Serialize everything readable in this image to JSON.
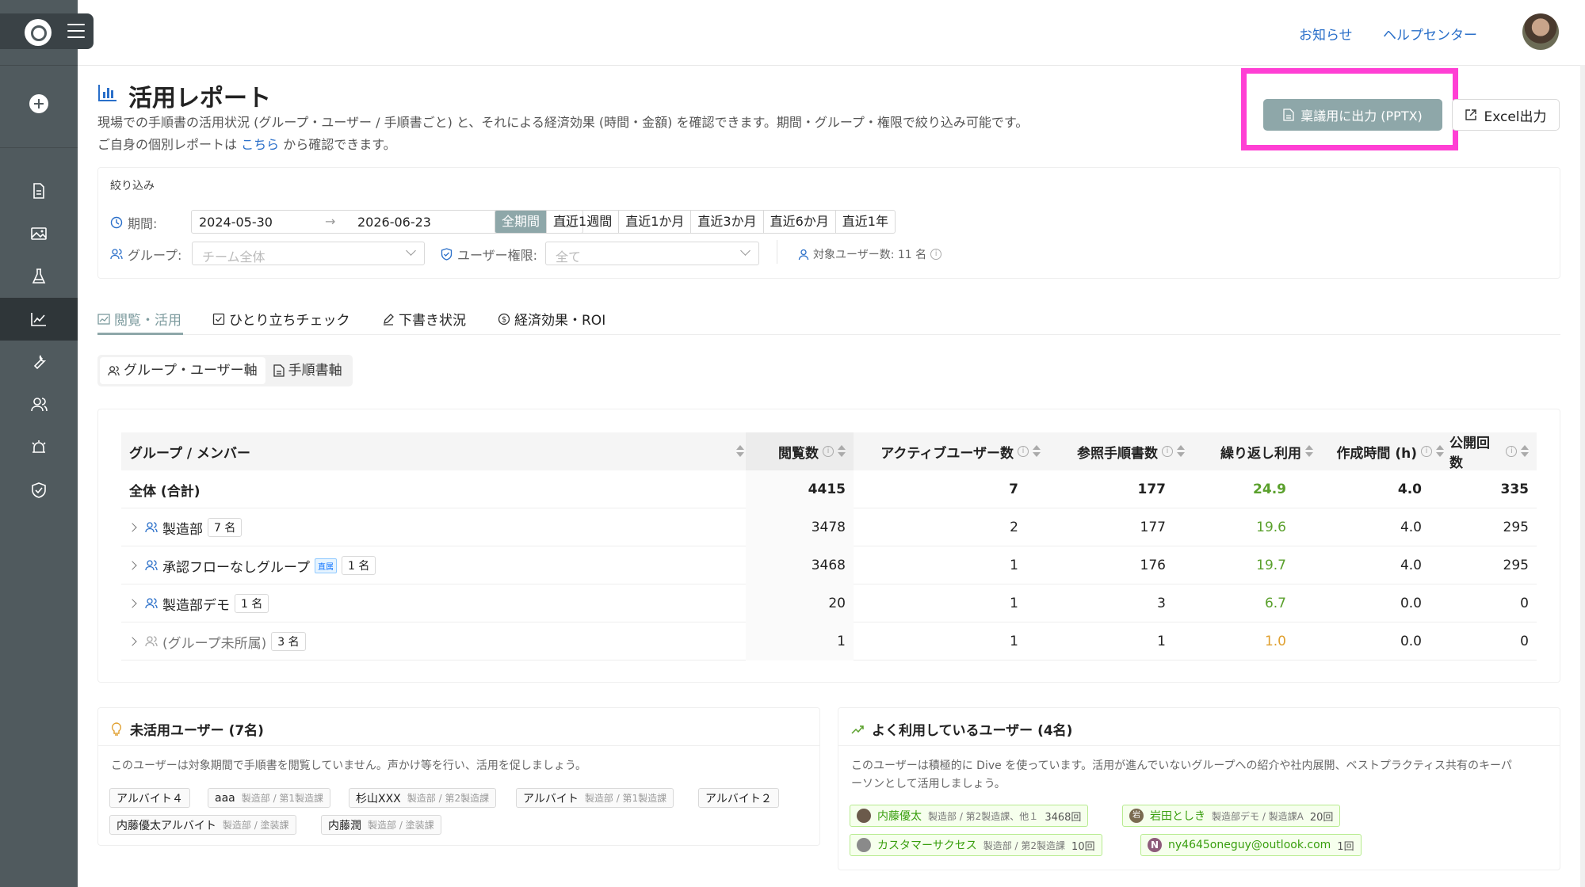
{
  "header": {
    "notice_link": "お知らせ",
    "help_link": "ヘルプセンター"
  },
  "page": {
    "title": "活用レポート",
    "desc_line1": "現場での手順書の活用状況 (グループ・ユーザー / 手順書ごと) と、それによる経済効果 (時間・金額) を確認できます。期間・グループ・権限で絞り込み可能です。",
    "desc_line2_pre": "ご自身の個別レポートは",
    "desc_line2_link": "こちら",
    "desc_line2_post": "から確認できます。",
    "pptx_button": "稟議用に出力 (PPTX)",
    "excel_button": "Excel出力"
  },
  "filter": {
    "title": "絞り込み",
    "period_label": "期間:",
    "date_from": "2024-05-30",
    "date_to": "2026-06-23",
    "presets": [
      "全期間",
      "直近1週間",
      "直近1か月",
      "直近3か月",
      "直近6か月",
      "直近1年"
    ],
    "group_label": "グループ:",
    "group_placeholder": "チーム全体",
    "role_label": "ユーザー権限:",
    "role_placeholder": "全て",
    "target_users": "対象ユーザー数: 11 名"
  },
  "tabs": [
    "閲覧・活用",
    "ひとり立ちチェック",
    "下書き状況",
    "経済効果・ROI"
  ],
  "subtabs": [
    "グループ・ユーザー軸",
    "手順書軸"
  ],
  "table": {
    "headers": [
      "グループ / メンバー",
      "閲覧数",
      "アクティブユーザー数",
      "参照手順書数",
      "繰り返し利用",
      "作成時間 (h)",
      "公開回数"
    ],
    "total": {
      "name": "全体 (合計)",
      "views": "4415",
      "active": "7",
      "docs": "177",
      "repeat": "24.9",
      "hours": "4.0",
      "published": "335"
    },
    "rows": [
      {
        "name": "製造部",
        "badge": "7 名",
        "tag": "",
        "views": "3478",
        "active": "2",
        "docs": "177",
        "repeat": "19.6",
        "hours": "4.0",
        "published": "295"
      },
      {
        "name": "承認フローなしグループ",
        "badge": "1 名",
        "tag": "直属",
        "views": "3468",
        "active": "1",
        "docs": "176",
        "repeat": "19.7",
        "hours": "4.0",
        "published": "295"
      },
      {
        "name": "製造部デモ",
        "badge": "1 名",
        "tag": "",
        "views": "20",
        "active": "1",
        "docs": "3",
        "repeat": "6.7",
        "hours": "0.0",
        "published": "0"
      },
      {
        "name": "(グループ未所属)",
        "badge": "3 名",
        "tag": "",
        "views": "1",
        "active": "1",
        "docs": "1",
        "repeat": "1.0",
        "hours": "0.0",
        "published": "0"
      }
    ]
  },
  "inactive": {
    "title": "未活用ユーザー (7名)",
    "desc": "このユーザーは対象期間で手順書を閲覧していません。声かけ等を行い、活用を促しましょう。",
    "users": [
      {
        "name": "アルバイト４",
        "sub": ""
      },
      {
        "name": "aaa",
        "sub": "製造部 / 第1製造課"
      },
      {
        "name": "杉山XXX",
        "sub": "製造部 / 第2製造課"
      },
      {
        "name": "アルバイト",
        "sub": "製造部 / 第1製造課"
      },
      {
        "name": "アルバイト２",
        "sub": ""
      },
      {
        "name": "内藤優太アルバイト",
        "sub": "製造部 / 塗装課"
      },
      {
        "name": "内藤潤",
        "sub": "製造部 / 塗装課"
      }
    ]
  },
  "active_users": {
    "title": "よく利用しているユーザー (4名)",
    "desc_line1": "このユーザーは積極的に Dive を使っています。活用が進んでいないグループへの紹介や社内展開、ベストプラクティス共有のキーパ",
    "desc_line2": "ーソンとして活用しましょう。",
    "users": [
      {
        "name": "内藤優太",
        "sub": "製造部 / 第2製造課、他１",
        "count": "3468回",
        "avatar": ""
      },
      {
        "name": "岩田としき",
        "sub": "製造部デモ / 製造課A",
        "count": "20回",
        "avatar": "岩"
      },
      {
        "name": "カスタマーサクセス",
        "sub": "製造部 / 第2製造課",
        "count": "10回",
        "avatar": ""
      },
      {
        "name": "ny4645oneguy@outlook.com",
        "sub": "",
        "count": "1回",
        "avatar": "N"
      }
    ]
  },
  "colors": {
    "sidebar": "#505a5e",
    "accent": "#8ea7a9",
    "highlight": "#ff3fd4",
    "link": "#2a6fc9",
    "green": "#5aa02c",
    "orange": "#e0a030"
  }
}
